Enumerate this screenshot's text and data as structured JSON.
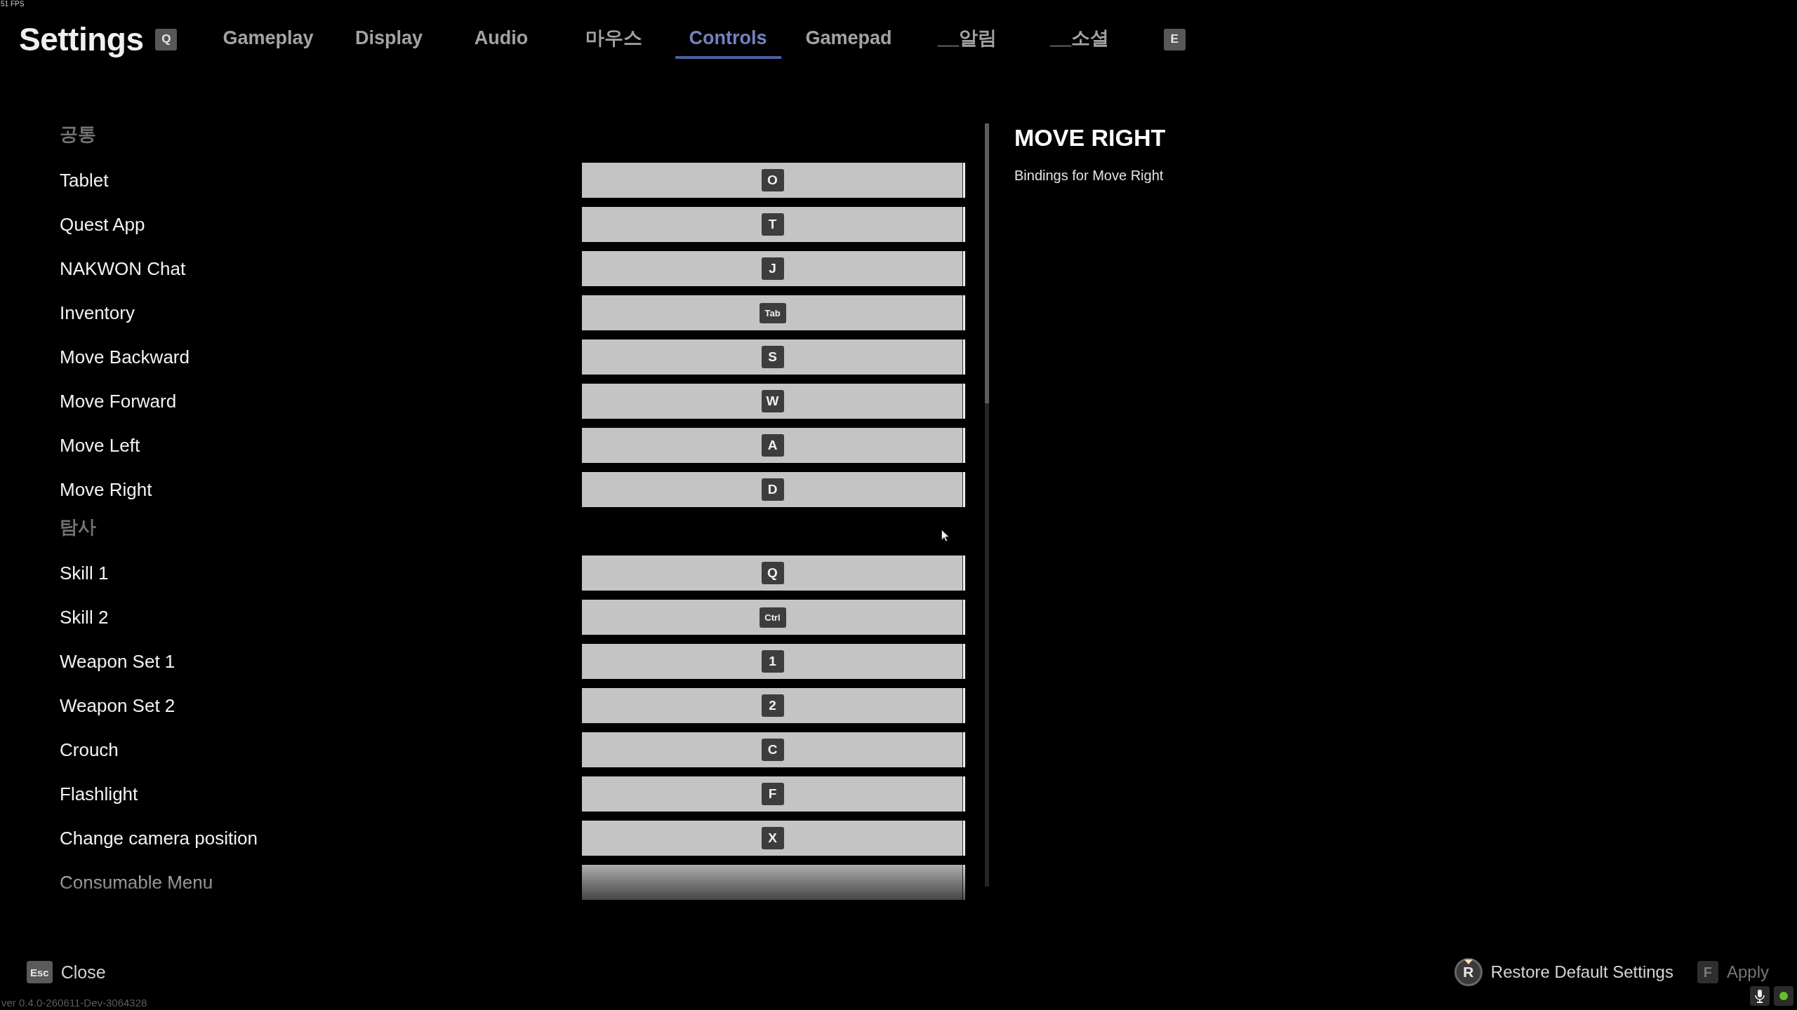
{
  "debug": {
    "fps": "51 FPS",
    "version": "ver 0.4.0-260611-Dev-3064328"
  },
  "header": {
    "title": "Settings",
    "prev_tab_key": "Q",
    "next_tab_key": "E",
    "tabs": [
      {
        "label": "Gameplay",
        "selected": false
      },
      {
        "label": "Display",
        "selected": false
      },
      {
        "label": "Audio",
        "selected": false
      },
      {
        "label": "마우스",
        "selected": false
      },
      {
        "label": "Controls",
        "selected": true
      },
      {
        "label": "Gamepad",
        "selected": false
      },
      {
        "label": "__알림",
        "selected": false
      },
      {
        "label": "__소셜",
        "selected": false
      }
    ]
  },
  "bindings": {
    "sections": [
      {
        "title": "공통",
        "rows": [
          {
            "action": "Tablet",
            "key": "O"
          },
          {
            "action": "Quest App",
            "key": "T"
          },
          {
            "action": "NAKWON Chat",
            "key": "J"
          },
          {
            "action": "Inventory",
            "key": "Tab"
          },
          {
            "action": "Move Backward",
            "key": "S"
          },
          {
            "action": "Move Forward",
            "key": "W"
          },
          {
            "action": "Move Left",
            "key": "A"
          },
          {
            "action": "Move Right",
            "key": "D"
          }
        ]
      },
      {
        "title": "탐사",
        "rows": [
          {
            "action": "Skill 1",
            "key": "Q"
          },
          {
            "action": "Skill 2",
            "key": "Ctrl"
          },
          {
            "action": "Weapon Set 1",
            "key": "1"
          },
          {
            "action": "Weapon Set 2",
            "key": "2"
          },
          {
            "action": "Crouch",
            "key": "C"
          },
          {
            "action": "Flashlight",
            "key": "F"
          },
          {
            "action": "Change camera position",
            "key": "X"
          },
          {
            "action": "Consumable Menu"
          }
        ]
      }
    ]
  },
  "details": {
    "title": "MOVE RIGHT",
    "description": "Bindings for Move Right"
  },
  "footer": {
    "close": {
      "key": "Esc",
      "label": "Close"
    },
    "actions": [
      {
        "kind": "hold",
        "key": "R",
        "label": "Restore Default Settings",
        "disabled": false
      },
      {
        "kind": "press",
        "key": "F",
        "label": "Apply",
        "disabled": true
      }
    ]
  }
}
